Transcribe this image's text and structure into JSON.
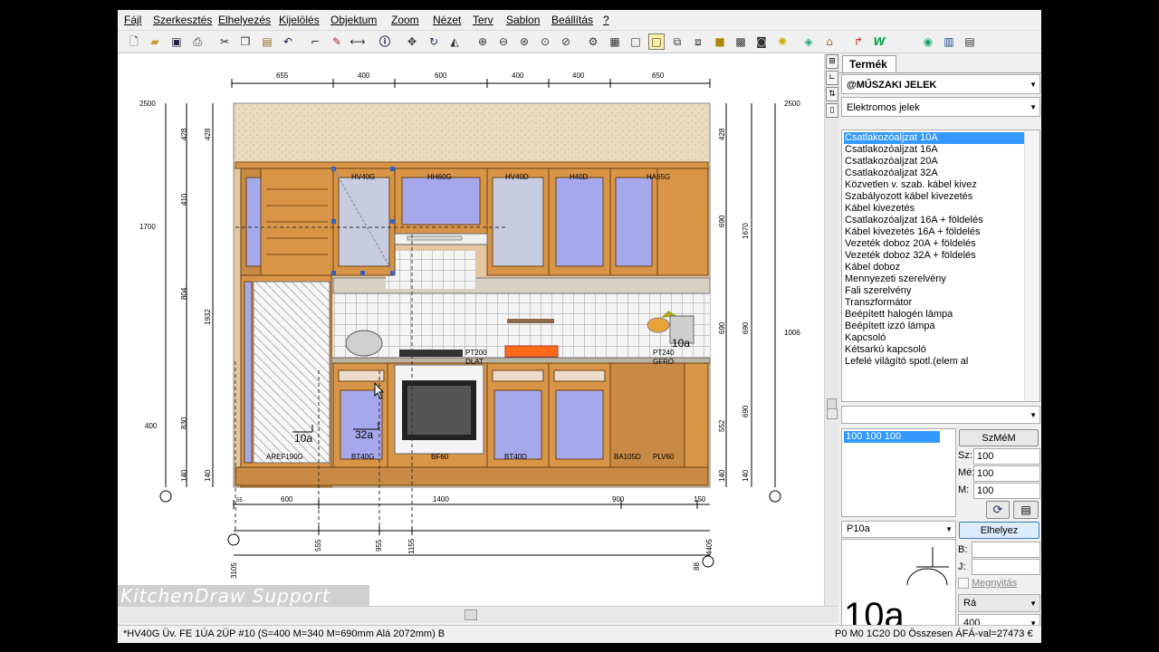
{
  "menu": [
    "Fájl",
    "Szerkesztés",
    "Elhelyezés",
    "Kijelölés",
    "Objektum",
    "Zoom",
    "Nézet",
    "Terv",
    "Sablon",
    "Beállítás",
    "?"
  ],
  "toolbar_icons": [
    "new-file-icon",
    "open-folder-icon",
    "save-icon",
    "print-icon",
    "cut-icon",
    "copy-icon",
    "paste-icon",
    "undo-icon",
    "stairs-icon",
    "paint-icon",
    "dimension-icon",
    "info-icon",
    "move-icon",
    "rotate-icon",
    "mirror-icon",
    "zoom-in-icon",
    "zoom-out-icon",
    "zoom-window-icon",
    "zoom-all-icon",
    "zoom-previous-icon",
    "settings-icon",
    "frame-icon",
    "plan-view-icon",
    "elevation-view-icon",
    "wireframe-icon",
    "box-icon",
    "solid-icon",
    "render-icon",
    "camera-icon",
    "light-icon",
    "texture-icon",
    "furniture-icon",
    "export-icon",
    "word-icon",
    "globe-icon",
    "catalog-icon",
    "calculator-icon"
  ],
  "drawing": {
    "top_dims": [
      "655",
      "400",
      "600",
      "400",
      "400",
      "650"
    ],
    "bottom_dims": [
      "600",
      "1400",
      "900",
      "150"
    ],
    "bottom_small": "55",
    "left_outer": [
      "2500",
      "1700",
      "400"
    ],
    "left_mid": [
      "428",
      "410",
      "804",
      "830",
      "140"
    ],
    "left_inner": [
      "428",
      "1932",
      "140"
    ],
    "right_inner": [
      "428",
      "690",
      "690",
      "690",
      "552",
      "140"
    ],
    "right_mid": [
      "1670",
      "690",
      "140"
    ],
    "right_outer": [
      "2500",
      "1006"
    ],
    "axis_labels": [
      "3105",
      "555",
      "955",
      "1155",
      "88",
      "4405"
    ],
    "top_labels": [
      "HV40G",
      "HH60G",
      "HV40D",
      "H40D",
      "HA65G"
    ],
    "mid_labels": [
      "PT200",
      "DLAT",
      "PT240",
      "GFRO"
    ],
    "bottom_labels": [
      "AREF190G",
      "BT40G",
      "BF60",
      "BT40D",
      "BA105D",
      "PLV60"
    ],
    "symbols": [
      "10a",
      "32a",
      "10a"
    ]
  },
  "watermark": "KitchenDraw Support",
  "status": {
    "left": "*HV40G  Üv. FE 1ÚA 2ÜP #10  (S=400 M=340 M=690mm Alá 2072mm) B",
    "right": "P0 M0 1C20 D0 Összesen ÁFÁ-val=27473 €"
  },
  "panel": {
    "tab": "Termék",
    "category": "@MŰSZAKI JELEK",
    "subcategory": "Elektromos jelek",
    "items": [
      "Csatlakozóaljzat 10A",
      "Csatlakozóaljzat 16A",
      "Csatlakozóaljzat 20A",
      "Csatlakozóaljzat 32A",
      "Közvetlen v. szab. kábel kivez",
      "Szabályozott kábel kivezetés",
      "Kábel kivezetés",
      "Csatlakozóaljzat 16A + földelés",
      "Kábel kivezetés 16A + földelés",
      "Vezeték doboz 20A + földelés",
      "Vezeték doboz 32A + földelés",
      "Kábel doboz",
      "Mennyezeti szerelvény",
      "Fali szerelvény",
      "Transzformátor",
      "Beépített halogén lámpa",
      "Beépített izzó lámpa",
      "Kapcsoló",
      "Kétsarkú kapcsoló",
      "Lefelé világító spotl.(elem al"
    ],
    "selected_item": 0,
    "empty_dropdown": "",
    "size_item": "100  100  100",
    "szmem_label": "SzMéM",
    "sz_label": "Sz:",
    "sz_value": "100",
    "me_label": "Mé:",
    "me_value": "100",
    "m_label": "M:",
    "m_value": "100",
    "code": "P10a",
    "place_label": "Elhelyez",
    "b_label": "B:",
    "b_value": "",
    "j_label": "J:",
    "j_value": "",
    "open_label": "Megnyitás",
    "ra_label": "Rá",
    "height_value": "400",
    "preview_text": "10a"
  }
}
